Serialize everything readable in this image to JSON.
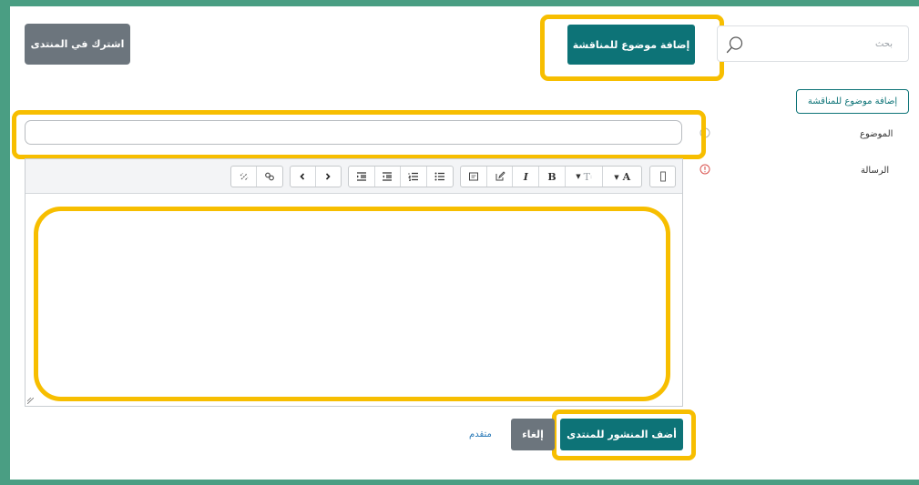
{
  "header": {
    "subscribe_button": "اشترك في المنتدى",
    "add_topic_button": "إضافة موضوع للمناقشة",
    "search_placeholder": "بحث"
  },
  "form": {
    "add_topic_outline_button": "إضافة موضوع للمناقشة",
    "subject_label": "الموضوع",
    "subject_value": "",
    "message_label": "الرسالة",
    "message_body": ""
  },
  "toolbar": {
    "groups": [
      [
        "unlink-icon",
        "link-icon"
      ],
      [
        "chevron-left-icon",
        "chevron-right-icon"
      ],
      [
        "indent-icon",
        "outdent-icon",
        "ordered-list-icon",
        "bullet-list-icon"
      ],
      [
        "media-icon",
        "edit-icon",
        "italic",
        "bold",
        "font-size",
        "font-color"
      ],
      [
        "expand-icon"
      ]
    ],
    "italic_label": "I",
    "bold_label": "B",
    "font_size_label": "T",
    "font_color_label": "A"
  },
  "footer": {
    "post_button": "أضف المنشور للمنتدى",
    "cancel_button": "إلغاء",
    "advanced_link": "متقدم"
  },
  "colors": {
    "frame": "#4a9e83",
    "primary": "#0d7377",
    "secondary": "#6c757d",
    "highlight": "#f7be00",
    "link": "#2a7ab8",
    "required": "#d9534f"
  }
}
